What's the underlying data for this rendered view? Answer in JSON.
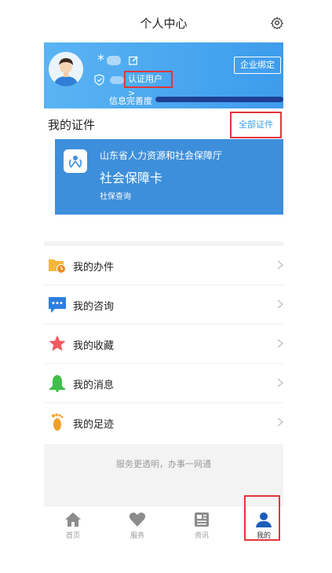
{
  "header": {
    "title": "个人中心",
    "settings_icon": "gear-icon"
  },
  "profile": {
    "name_prefix": "*",
    "auth_label": "认证用户",
    "auth_chevron": ">",
    "bind_button": "企业绑定",
    "progress_label": "信息完善度",
    "progress_value": 1.0
  },
  "certificates": {
    "title": "我的证件",
    "all_link": "全部证件",
    "card": {
      "org": "山东省人力资源和社会保障厅",
      "name": "社会保障卡",
      "subtitle": "社保查询",
      "color": "#3d8fdb"
    }
  },
  "menu": {
    "items": [
      {
        "label": "我的办件",
        "icon": "folder-clock-icon"
      },
      {
        "label": "我的咨询",
        "icon": "chat-bubble-icon"
      },
      {
        "label": "我的收藏",
        "icon": "star-icon"
      },
      {
        "label": "我的消息",
        "icon": "bell-icon"
      },
      {
        "label": "我的足迹",
        "icon": "footprint-icon"
      }
    ]
  },
  "footer": {
    "slogan": "服务更透明，办事一网通"
  },
  "tabbar": {
    "items": [
      {
        "label": "首页",
        "icon": "home-icon"
      },
      {
        "label": "服务",
        "icon": "heart-icon"
      },
      {
        "label": "资讯",
        "icon": "news-icon"
      },
      {
        "label": "我的",
        "icon": "user-icon",
        "active": true
      }
    ]
  },
  "colors": {
    "accent": "#3d9cec",
    "highlight": "#e2363c",
    "tab_active": "#1a5db8"
  }
}
